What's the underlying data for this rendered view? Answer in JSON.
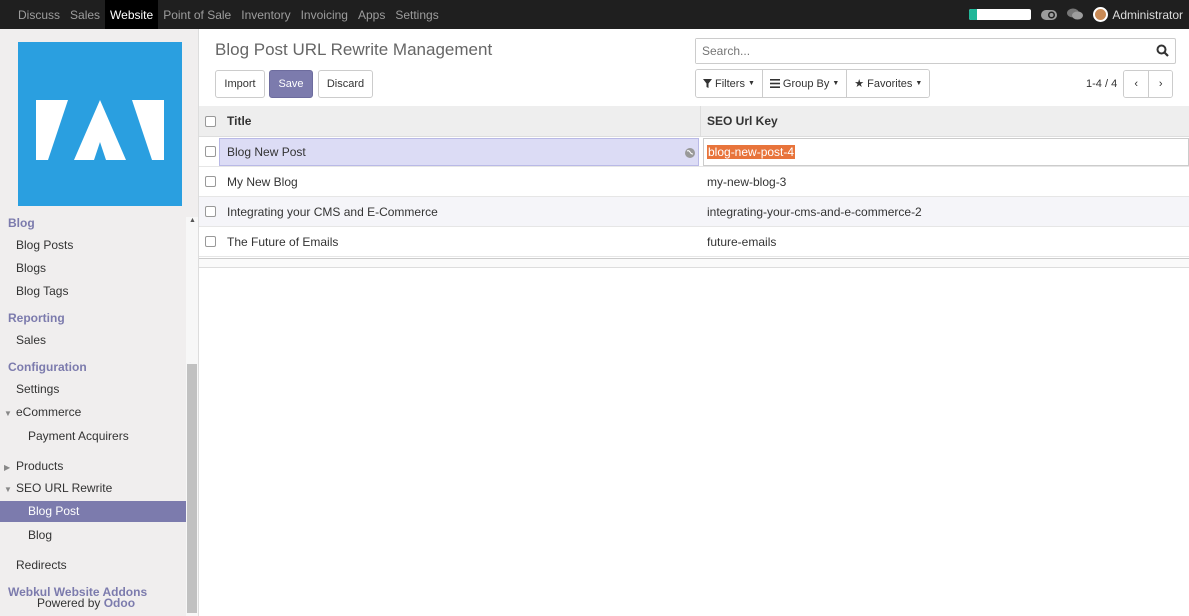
{
  "topbar": {
    "menu": [
      "Discuss",
      "Sales",
      "Website",
      "Point of Sale",
      "Inventory",
      "Invoicing",
      "Apps",
      "Settings"
    ],
    "active": "Website",
    "user": "Administrator",
    "progress": 0.12,
    "colors": {
      "bar": "#1f1f1f",
      "active": "#000000"
    }
  },
  "sidebar": {
    "sections": {
      "blog": "Blog",
      "blog_posts": "Blog Posts",
      "blogs": "Blogs",
      "blog_tags": "Blog Tags",
      "reporting": "Reporting",
      "sales": "Sales",
      "configuration": "Configuration",
      "settings": "Settings",
      "ecommerce": "eCommerce",
      "payment_acquirers": "Payment Acquirers",
      "products": "Products",
      "seo_url_rewrite": "SEO URL Rewrite",
      "blog_post": "Blog Post",
      "blog_sub": "Blog",
      "redirects": "Redirects",
      "webkul": "Webkul Website Addons"
    },
    "powered_prefix": "Powered by ",
    "powered_brand": "Odoo",
    "accent": "#7c7bad",
    "logo_color": "#2a9fe0"
  },
  "main": {
    "title": "Blog Post URL Rewrite Management",
    "buttons": {
      "import": "Import",
      "save": "Save",
      "discard": "Discard"
    },
    "search_placeholder": "Search...",
    "filters": {
      "filters": "Filters",
      "group_by": "Group By",
      "favorites": "Favorites"
    },
    "pager": "1-4 / 4",
    "columns": {
      "title": "Title",
      "seo": "SEO Url Key"
    },
    "rows": [
      {
        "title": "Blog New Post",
        "seo": "blog-new-post-4"
      },
      {
        "title": "My New Blog",
        "seo": "my-new-blog-3"
      },
      {
        "title": "Integrating your CMS and E-Commerce",
        "seo": "integrating-your-cms-and-e-commerce-2"
      },
      {
        "title": "The Future of Emails",
        "seo": "future-emails"
      }
    ]
  }
}
